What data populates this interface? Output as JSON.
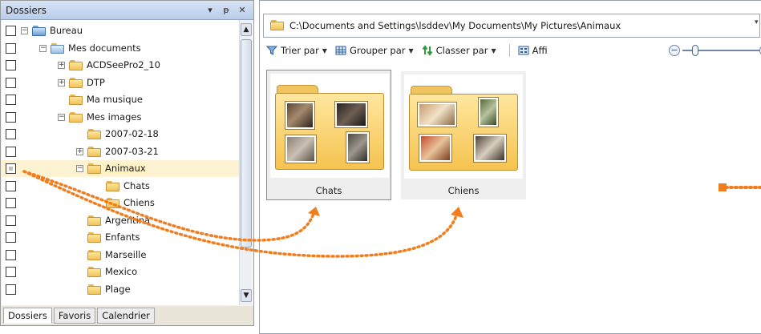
{
  "left_panel": {
    "title": "Dossiers",
    "header_buttons": [
      "▾",
      "ᵽ",
      "✕"
    ],
    "tree": [
      {
        "label": "Bureau",
        "level": 0,
        "expander": "−",
        "checkbox": "empty",
        "icon": "desktop"
      },
      {
        "label": "Mes documents",
        "level": 1,
        "expander": "−",
        "checkbox": "empty",
        "icon": "documents"
      },
      {
        "label": "ACDSeePro2_10",
        "level": 2,
        "expander": "+",
        "checkbox": "empty",
        "icon": "folder"
      },
      {
        "label": "DTP",
        "level": 2,
        "expander": "+",
        "checkbox": "empty",
        "icon": "folder"
      },
      {
        "label": "Ma musique",
        "level": 2,
        "expander": "",
        "checkbox": "empty",
        "icon": "music-folder"
      },
      {
        "label": "Mes images",
        "level": 2,
        "expander": "−",
        "checkbox": "empty",
        "icon": "pictures-folder"
      },
      {
        "label": "2007-02-18",
        "level": 3,
        "expander": "",
        "checkbox": "empty",
        "icon": "folder"
      },
      {
        "label": "2007-03-21",
        "level": 3,
        "expander": "+",
        "checkbox": "empty",
        "icon": "folder"
      },
      {
        "label": "Animaux",
        "level": 3,
        "expander": "−",
        "checkbox": "partial",
        "icon": "folder",
        "selected": true
      },
      {
        "label": "Chats",
        "level": 4,
        "expander": "",
        "checkbox": "empty",
        "icon": "folder"
      },
      {
        "label": "Chiens",
        "level": 4,
        "expander": "",
        "checkbox": "empty",
        "icon": "folder"
      },
      {
        "label": "Argentina",
        "level": 3,
        "expander": "",
        "checkbox": "empty",
        "icon": "folder"
      },
      {
        "label": "Enfants",
        "level": 3,
        "expander": "",
        "checkbox": "empty",
        "icon": "folder"
      },
      {
        "label": "Marseille",
        "level": 3,
        "expander": "",
        "checkbox": "empty",
        "icon": "folder"
      },
      {
        "label": "Mexico",
        "level": 3,
        "expander": "",
        "checkbox": "empty",
        "icon": "folder"
      },
      {
        "label": "Plage",
        "level": 3,
        "expander": "",
        "checkbox": "empty",
        "icon": "folder"
      }
    ],
    "tabs": [
      {
        "label": "Dossiers",
        "active": true
      },
      {
        "label": "Favoris",
        "active": false
      },
      {
        "label": "Calendrier",
        "active": false
      }
    ]
  },
  "address_bar": {
    "path": "C:\\Documents and Settings\\lsddev\\My Documents\\My Pictures\\Animaux"
  },
  "toolbar": {
    "sort_label": "Trier par",
    "group_label": "Grouper par",
    "order_label": "Classer par",
    "view_label": "Affi"
  },
  "thumbnails": [
    {
      "label": "Chats",
      "selected": true
    },
    {
      "label": "Chiens",
      "selected": false
    }
  ],
  "colors": {
    "annotation_orange": "#f07d1e",
    "header_blue": "#b9cde9",
    "folder_yellow": "#f5c34f",
    "selection": "#fdf3d2"
  }
}
